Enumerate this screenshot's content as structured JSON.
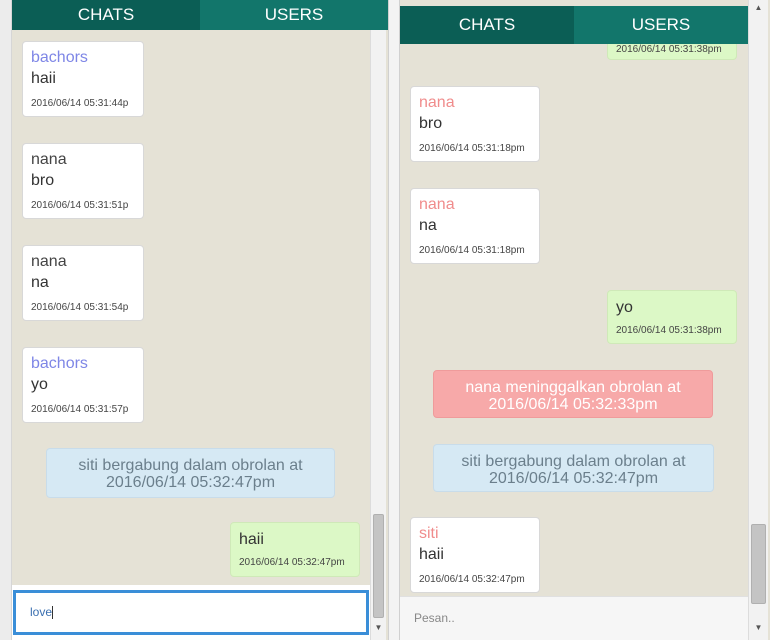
{
  "left": {
    "tabs": {
      "chats": "CHATS",
      "users": "USERS"
    },
    "messages": [
      {
        "sender": "bachors",
        "text": "haii",
        "time": "2016/06/14 05:31:44p"
      },
      {
        "sender": "nana",
        "text": "bro",
        "time": "2016/06/14 05:31:51p"
      },
      {
        "sender": "nana",
        "text": "na",
        "time": "2016/06/14 05:31:54p"
      },
      {
        "sender": "bachors",
        "text": "yo",
        "time": "2016/06/14 05:31:57p"
      }
    ],
    "system": {
      "line1": "siti bergabung dalam obrolan at",
      "line2": "2016/06/14 05:32:47pm"
    },
    "own": {
      "text": "haii",
      "time": "2016/06/14 05:32:47pm"
    },
    "input_value": "love"
  },
  "right": {
    "tabs": {
      "chats": "CHATS",
      "users": "USERS"
    },
    "partial_time": "2016/06/14 05:31:38pm",
    "messages": [
      {
        "sender": "nana",
        "text": "bro",
        "time": "2016/06/14 05:31:18pm"
      },
      {
        "sender": "nana",
        "text": "na",
        "time": "2016/06/14 05:31:18pm"
      }
    ],
    "own": {
      "text": "yo",
      "time": "2016/06/14 05:31:38pm"
    },
    "leave": {
      "line1": "nana meninggalkan obrolan at",
      "line2": "2016/06/14 05:32:33pm"
    },
    "join": {
      "line1": "siti bergabung dalam obrolan at",
      "line2": "2016/06/14 05:32:47pm"
    },
    "last": {
      "sender": "siti",
      "text": "haii",
      "time": "2016/06/14 05:32:47pm"
    },
    "input_placeholder": "Pesan.."
  },
  "colors": {
    "tab_active": "#0b5e55",
    "tab_inactive": "#12766b",
    "chat_bg": "#e5e2d6",
    "sender_left": "#7e86e6",
    "sender_right": "#f08c8c",
    "own_bubble": "#dcf8c6",
    "join_bg": "#d6e9f4",
    "leave_bg": "#f7a9a9",
    "input_focus": "#3a8ed8"
  }
}
